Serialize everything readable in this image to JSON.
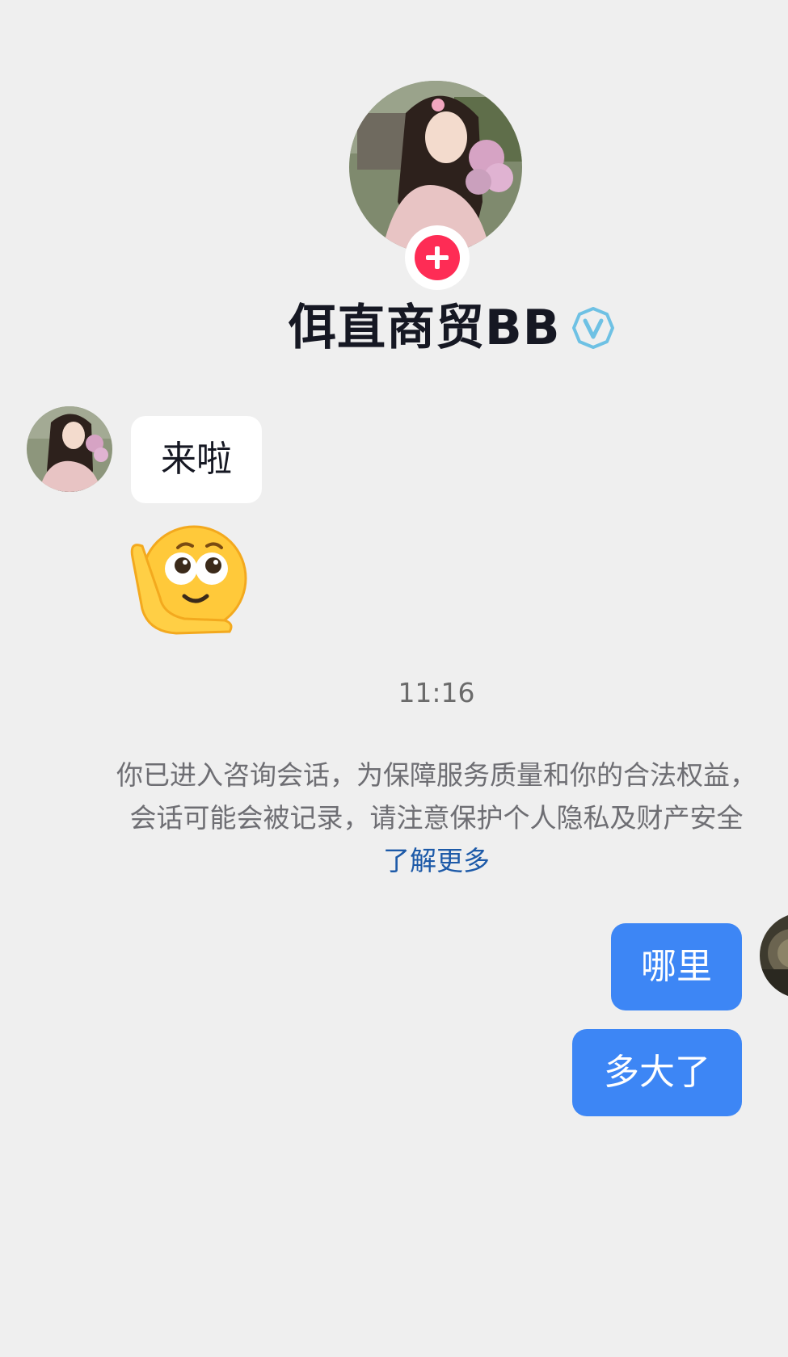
{
  "header": {
    "name": "佴直商贸BB",
    "verified_icon": "verified-v-badge-icon",
    "follow_icon": "plus-icon",
    "colors": {
      "follow": "#fe2c55",
      "verified": "#6ec1e4"
    }
  },
  "messages": [
    {
      "from": "peer",
      "text": "来啦"
    },
    {
      "from": "peer",
      "sticker": "hand-on-cheek-thinking-emoji"
    }
  ],
  "timestamp": "11:16",
  "notice": {
    "text": "你已进入咨询会话，为保障服务质量和你的合法权益，会话可能会被记录，请注意保护个人隐私及财产安全",
    "link": "了解更多"
  },
  "outgoing": [
    {
      "text": "哪里"
    },
    {
      "text": "多大了"
    }
  ],
  "colors": {
    "background": "#efefef",
    "outgoing_bubble": "#3d86f5",
    "incoming_bubble": "#ffffff"
  }
}
